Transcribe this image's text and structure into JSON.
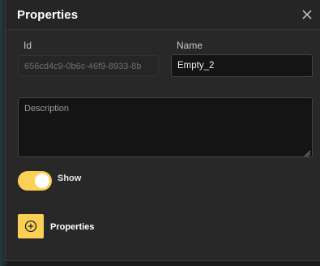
{
  "window": {
    "title": "Properties",
    "close_icon": "close-icon"
  },
  "fields": {
    "id_label": "Id",
    "id_value": "656cd4c9-0b6c-46f9-8933-8b",
    "name_label": "Name",
    "name_value": "Empty_2",
    "description_placeholder": "Description",
    "description_value": ""
  },
  "show_toggle": {
    "label": "Show",
    "checked": true
  },
  "properties_section": {
    "add_icon": "plus-circle-icon",
    "label": "Properties"
  },
  "colors": {
    "accent": "#fbd055",
    "panel_bg": "#282828",
    "header_bg": "#252525",
    "input_bg": "#141414"
  }
}
